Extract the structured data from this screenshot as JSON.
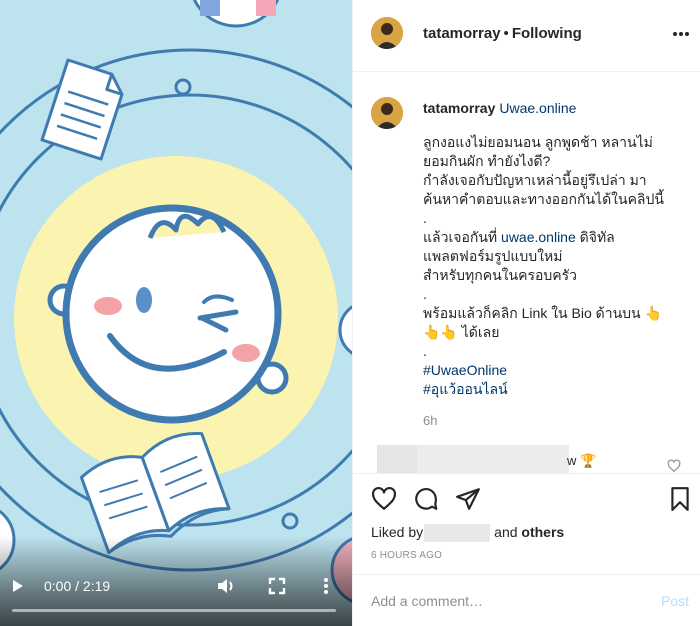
{
  "post": {
    "username": "tatamorray",
    "separator": "•",
    "follow_status": "Following",
    "more_icon": "ellipsis-icon"
  },
  "caption": {
    "username": "tatamorray",
    "site_link": "Uwae.online",
    "lines": [
      "ลูกงอแงไม่ยอมนอน ลูกพูดช้า หลานไม่",
      "ยอมกินผัก ทำยังไงดี?",
      "กำลังเจอกับปัญหาเหล่านี้อยู่รึเปล่า มา",
      "ค้นหาคำตอบและทางออกกันได้ในคลิปนี้",
      "."
    ],
    "line2_prefix": "แล้วเจอกันที่ ",
    "line2_link": "uwae.online",
    "line2_suffix": " ดิจิทัล",
    "lines_b": [
      "แพลตฟอร์มรูปแบบใหม่",
      "สำหรับทุกคนในครอบครัว",
      "."
    ],
    "line3": "พร้อมแล้วก็คลิก Link ใน Bio ด้านบน 👆",
    "line4": "👆👆 ได้เลย",
    "line5": ".",
    "hashtags": [
      "#UwaeOnline",
      "#อุแว้ออนไลน์"
    ],
    "time_ago": "6h"
  },
  "reply": {
    "text": "w 🏆"
  },
  "actions": {
    "liked_by_prefix": "Liked by",
    "liked_by_suffix": "and",
    "others": "others",
    "posted": "6 HOURS AGO"
  },
  "comment_box": {
    "placeholder": "Add a comment…",
    "post_label": "Post"
  },
  "video": {
    "time": "0:00 / 2:19",
    "progress": 0.0
  },
  "colors": {
    "background_light_blue": "#bde3ee",
    "sun_yellow": "#fbf4b0",
    "line_blue": "#3f7bb0",
    "link_blue": "#00376b",
    "post_button_disabled": "#b2dffc",
    "muted_text": "#8e8e8e"
  }
}
